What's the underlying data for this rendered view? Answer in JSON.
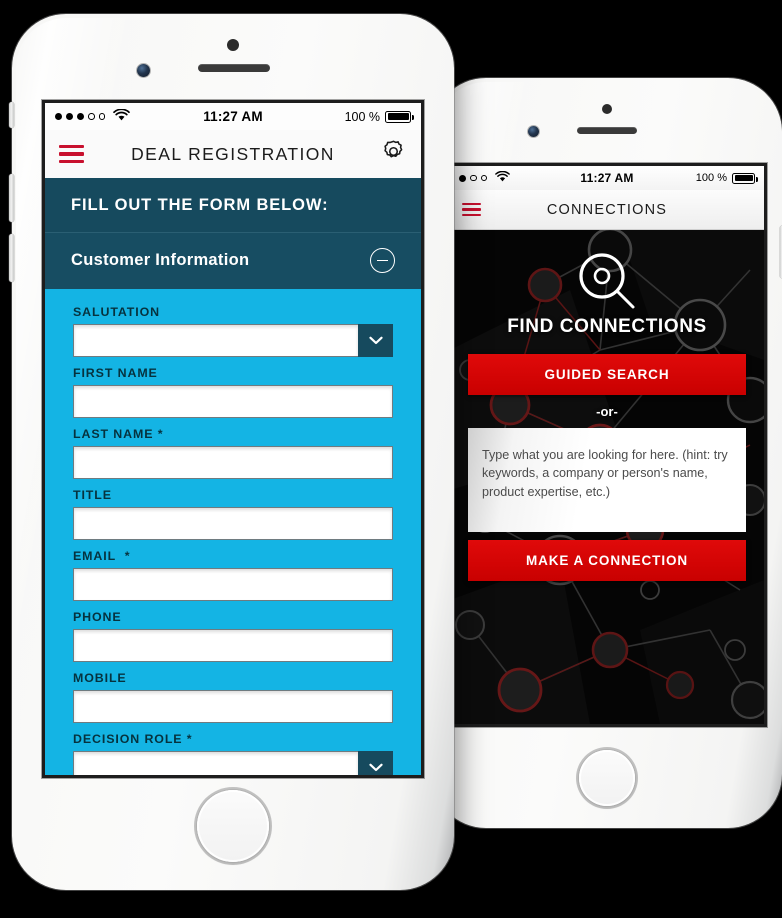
{
  "scene": {
    "background_color": "#000000",
    "device_count": 2
  },
  "phone_deal_registration": {
    "status_bar": {
      "signal_dots_filled": 3,
      "signal_dots_empty": 2,
      "wifi_icon": "wifi-icon",
      "time": "11:27 AM",
      "battery_percent": "100 %",
      "battery_level": 100
    },
    "nav": {
      "menu_icon": "hamburger-menu-icon",
      "title": "DEAL REGISTRATION",
      "settings_icon": "gear-icon"
    },
    "section_banner": "FILL OUT THE FORM BELOW:",
    "accordion": {
      "title": "Customer Information",
      "toggle_icon": "minus-circle-icon",
      "expanded": true
    },
    "fields": [
      {
        "label": "SALUTATION",
        "required": false,
        "type": "select",
        "value": "",
        "caret_icon": "chevron-down-icon"
      },
      {
        "label": "FIRST NAME",
        "required": false,
        "type": "text",
        "value": ""
      },
      {
        "label": "LAST NAME",
        "required": true,
        "type": "text",
        "value": ""
      },
      {
        "label": "TITLE",
        "required": false,
        "type": "text",
        "value": ""
      },
      {
        "label": "EMAIL",
        "required": true,
        "type": "text",
        "value": ""
      },
      {
        "label": "PHONE",
        "required": false,
        "type": "text",
        "value": ""
      },
      {
        "label": "MOBILE",
        "required": false,
        "type": "text",
        "value": ""
      },
      {
        "label": "DECISION ROLE",
        "required": true,
        "type": "select",
        "value": "",
        "caret_icon": "chevron-down-icon"
      }
    ],
    "colors": {
      "header_teal": "#164a5e",
      "accordion_teal": "#174d62",
      "form_cyan": "#14b4e4",
      "accent_red": "#c8102e",
      "label_dark": "#06323e"
    }
  },
  "phone_connections": {
    "status_bar": {
      "signal_dots_filled": 1,
      "signal_dots_empty": 2,
      "wifi_icon": "wifi-icon",
      "time": "11:27 AM",
      "battery_percent": "100 %",
      "battery_level": 100
    },
    "nav": {
      "menu_icon": "hamburger-menu-icon",
      "title": "CONNECTIONS"
    },
    "hero": {
      "icon": "magnifying-glass-icon",
      "title": "FIND CONNECTIONS"
    },
    "guided_search_button": "GUIDED SEARCH",
    "separator": "-or-",
    "search_input": {
      "placeholder": "Type what you are looking for here. (hint: try keywords, a company or person's name, product expertise, etc.)",
      "value": ""
    },
    "make_connection_button": "MAKE A CONNECTION",
    "colors": {
      "background": "#050505",
      "accent_red": "#cc0000",
      "node_red": "#5a1414"
    }
  }
}
